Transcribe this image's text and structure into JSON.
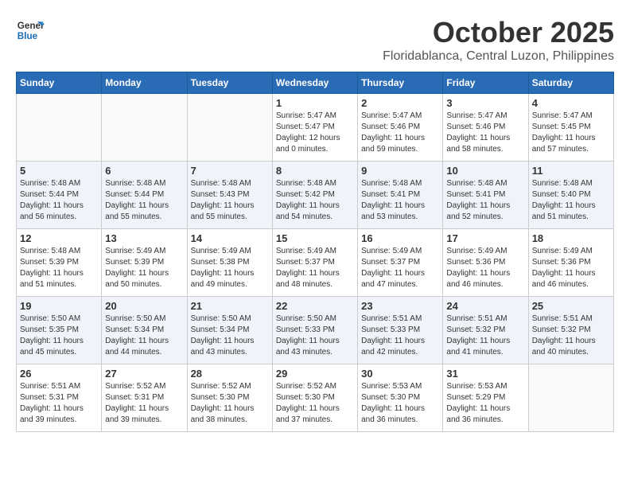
{
  "header": {
    "logo_line1": "General",
    "logo_line2": "Blue",
    "month": "October 2025",
    "location": "Floridablanca, Central Luzon, Philippines"
  },
  "weekdays": [
    "Sunday",
    "Monday",
    "Tuesday",
    "Wednesday",
    "Thursday",
    "Friday",
    "Saturday"
  ],
  "weeks": [
    [
      {
        "day": "",
        "info": ""
      },
      {
        "day": "",
        "info": ""
      },
      {
        "day": "",
        "info": ""
      },
      {
        "day": "1",
        "info": "Sunrise: 5:47 AM\nSunset: 5:47 PM\nDaylight: 12 hours\nand 0 minutes."
      },
      {
        "day": "2",
        "info": "Sunrise: 5:47 AM\nSunset: 5:46 PM\nDaylight: 11 hours\nand 59 minutes."
      },
      {
        "day": "3",
        "info": "Sunrise: 5:47 AM\nSunset: 5:46 PM\nDaylight: 11 hours\nand 58 minutes."
      },
      {
        "day": "4",
        "info": "Sunrise: 5:47 AM\nSunset: 5:45 PM\nDaylight: 11 hours\nand 57 minutes."
      }
    ],
    [
      {
        "day": "5",
        "info": "Sunrise: 5:48 AM\nSunset: 5:44 PM\nDaylight: 11 hours\nand 56 minutes."
      },
      {
        "day": "6",
        "info": "Sunrise: 5:48 AM\nSunset: 5:44 PM\nDaylight: 11 hours\nand 55 minutes."
      },
      {
        "day": "7",
        "info": "Sunrise: 5:48 AM\nSunset: 5:43 PM\nDaylight: 11 hours\nand 55 minutes."
      },
      {
        "day": "8",
        "info": "Sunrise: 5:48 AM\nSunset: 5:42 PM\nDaylight: 11 hours\nand 54 minutes."
      },
      {
        "day": "9",
        "info": "Sunrise: 5:48 AM\nSunset: 5:41 PM\nDaylight: 11 hours\nand 53 minutes."
      },
      {
        "day": "10",
        "info": "Sunrise: 5:48 AM\nSunset: 5:41 PM\nDaylight: 11 hours\nand 52 minutes."
      },
      {
        "day": "11",
        "info": "Sunrise: 5:48 AM\nSunset: 5:40 PM\nDaylight: 11 hours\nand 51 minutes."
      }
    ],
    [
      {
        "day": "12",
        "info": "Sunrise: 5:48 AM\nSunset: 5:39 PM\nDaylight: 11 hours\nand 51 minutes."
      },
      {
        "day": "13",
        "info": "Sunrise: 5:49 AM\nSunset: 5:39 PM\nDaylight: 11 hours\nand 50 minutes."
      },
      {
        "day": "14",
        "info": "Sunrise: 5:49 AM\nSunset: 5:38 PM\nDaylight: 11 hours\nand 49 minutes."
      },
      {
        "day": "15",
        "info": "Sunrise: 5:49 AM\nSunset: 5:37 PM\nDaylight: 11 hours\nand 48 minutes."
      },
      {
        "day": "16",
        "info": "Sunrise: 5:49 AM\nSunset: 5:37 PM\nDaylight: 11 hours\nand 47 minutes."
      },
      {
        "day": "17",
        "info": "Sunrise: 5:49 AM\nSunset: 5:36 PM\nDaylight: 11 hours\nand 46 minutes."
      },
      {
        "day": "18",
        "info": "Sunrise: 5:49 AM\nSunset: 5:36 PM\nDaylight: 11 hours\nand 46 minutes."
      }
    ],
    [
      {
        "day": "19",
        "info": "Sunrise: 5:50 AM\nSunset: 5:35 PM\nDaylight: 11 hours\nand 45 minutes."
      },
      {
        "day": "20",
        "info": "Sunrise: 5:50 AM\nSunset: 5:34 PM\nDaylight: 11 hours\nand 44 minutes."
      },
      {
        "day": "21",
        "info": "Sunrise: 5:50 AM\nSunset: 5:34 PM\nDaylight: 11 hours\nand 43 minutes."
      },
      {
        "day": "22",
        "info": "Sunrise: 5:50 AM\nSunset: 5:33 PM\nDaylight: 11 hours\nand 43 minutes."
      },
      {
        "day": "23",
        "info": "Sunrise: 5:51 AM\nSunset: 5:33 PM\nDaylight: 11 hours\nand 42 minutes."
      },
      {
        "day": "24",
        "info": "Sunrise: 5:51 AM\nSunset: 5:32 PM\nDaylight: 11 hours\nand 41 minutes."
      },
      {
        "day": "25",
        "info": "Sunrise: 5:51 AM\nSunset: 5:32 PM\nDaylight: 11 hours\nand 40 minutes."
      }
    ],
    [
      {
        "day": "26",
        "info": "Sunrise: 5:51 AM\nSunset: 5:31 PM\nDaylight: 11 hours\nand 39 minutes."
      },
      {
        "day": "27",
        "info": "Sunrise: 5:52 AM\nSunset: 5:31 PM\nDaylight: 11 hours\nand 39 minutes."
      },
      {
        "day": "28",
        "info": "Sunrise: 5:52 AM\nSunset: 5:30 PM\nDaylight: 11 hours\nand 38 minutes."
      },
      {
        "day": "29",
        "info": "Sunrise: 5:52 AM\nSunset: 5:30 PM\nDaylight: 11 hours\nand 37 minutes."
      },
      {
        "day": "30",
        "info": "Sunrise: 5:53 AM\nSunset: 5:30 PM\nDaylight: 11 hours\nand 36 minutes."
      },
      {
        "day": "31",
        "info": "Sunrise: 5:53 AM\nSunset: 5:29 PM\nDaylight: 11 hours\nand 36 minutes."
      },
      {
        "day": "",
        "info": ""
      }
    ]
  ]
}
